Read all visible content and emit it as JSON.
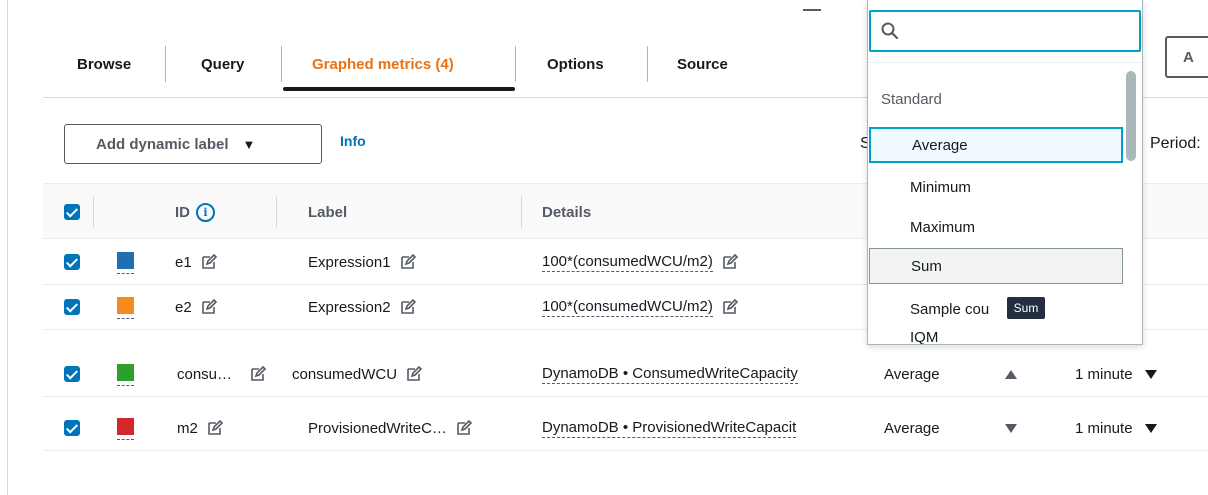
{
  "tabs": [
    {
      "label": "Browse"
    },
    {
      "label": "Query"
    },
    {
      "label": "Graphed metrics (4)"
    },
    {
      "label": "Options"
    },
    {
      "label": "Source"
    }
  ],
  "right_button_label": "A",
  "toolbar": {
    "dynamic_label_button": "Add dynamic label",
    "info_link": "Info",
    "statistic_partial": "S",
    "period_label": "Period:"
  },
  "table": {
    "headers": {
      "id": "ID",
      "label": "Label",
      "details": "Details"
    },
    "rows": [
      {
        "color": "#1f6fb5",
        "id": "e1",
        "label": "Expression1",
        "details": "100*(consumedWCU/m2)",
        "statistic": "",
        "period": ""
      },
      {
        "color": "#f58a1f",
        "id": "e2",
        "label": "Expression2",
        "details": "100*(consumedWCU/m2)",
        "statistic": "",
        "period": ""
      },
      {
        "color": "#2ca02c",
        "id": "consu…",
        "label": "consumedWCU",
        "details": "DynamoDB • ConsumedWriteCapacity",
        "statistic": "Average",
        "period": "1 minute"
      },
      {
        "color": "#d62728",
        "id": "m2",
        "label": "ProvisionedWriteC…",
        "details": "DynamoDB • ProvisionedWriteCapacit",
        "statistic": "Average",
        "period": "1 minute"
      }
    ]
  },
  "dropdown": {
    "search_value": "",
    "group_label": "Standard",
    "options": [
      "Average",
      "Minimum",
      "Maximum",
      "Sum",
      "Sample cou",
      "IQM"
    ],
    "selected": "Average",
    "hovered": "Sum",
    "tooltip": "Sum"
  }
}
